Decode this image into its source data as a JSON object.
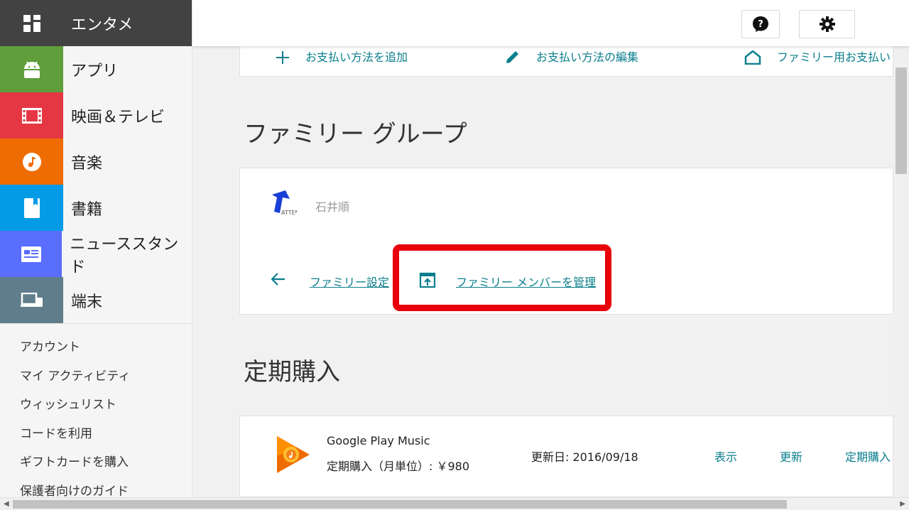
{
  "sidebar": {
    "categories": [
      {
        "label": "エンタメ",
        "color": "#424242",
        "icon": "apps-grid-icon"
      },
      {
        "label": "アプリ",
        "color": "#5f9e3b",
        "icon": "android-icon"
      },
      {
        "label": "映画＆テレビ",
        "color": "#e53743",
        "icon": "film-icon"
      },
      {
        "label": "音楽",
        "color": "#ef6c00",
        "icon": "music-note-icon"
      },
      {
        "label": "書籍",
        "color": "#039be5",
        "icon": "book-icon"
      },
      {
        "label": "ニューススタンド",
        "color": "#596dff",
        "icon": "news-icon"
      },
      {
        "label": "端末",
        "color": "#607d8b",
        "icon": "devices-icon"
      }
    ],
    "links": [
      "アカウント",
      "マイ アクティビティ",
      "ウィッシュリスト",
      "コードを利用",
      "ギフトカードを購入",
      "保護者向けのガイド"
    ]
  },
  "header": {
    "help_icon": "help-icon",
    "settings_icon": "gear-icon"
  },
  "payment": {
    "add_label": "お支払い方法を追加",
    "edit_label": "お支払い方法の編集",
    "family_label": "ファミリー用お支払い"
  },
  "family": {
    "title": "ファミリー グループ",
    "member_name": "石井順",
    "settings_link": "ファミリー設定",
    "manage_link": "ファミリー メンバーを管理",
    "highlight_color": "#e8000a"
  },
  "subscriptions": {
    "title": "定期購入",
    "item": {
      "name": "Google Play Music",
      "price": "定期購入（月単位）: ￥980",
      "renewal": "更新日: 2016/09/18",
      "view_label": "表示",
      "renew_label": "更新",
      "manage_label": "定期購入"
    }
  },
  "accent_color": "#0a7e8c"
}
